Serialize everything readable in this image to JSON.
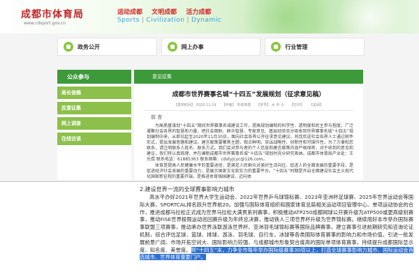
{
  "site": {
    "logo_title": "成都市体育局",
    "logo_url": "www.cdsport.gov.cn",
    "slogans_cn": [
      "运动成都",
      "文明成都",
      "活力成都"
    ],
    "slogans_en": [
      "Sports",
      "Civilization",
      "Dynamic"
    ],
    "nav": [
      "政务公开",
      "网上办事",
      "行业管理"
    ],
    "sidebar": {
      "heading": "公众参与",
      "items": [
        "局长信箱",
        "民意征集",
        "网上调查",
        "在线访谈"
      ]
    },
    "main": {
      "section_title": "意见征集",
      "article_title": "成都市世界赛事名城“十四五”发展规划（征求意见稿）",
      "meta": [
        "【发布时间】 2020-11-19",
        "【作者】 市体育局",
        "【字号】 大 中 小",
        "【打印】",
        "【关闭】"
      ],
      "preface": "前  言",
      "paragraphs": [
        "为高质量谋划“十四五”期间世界赛事名城建设工作，提高规划编制的科学性、透明度和民主参与程度，广泛凝聚社会各界的智慧和力量，把社会期盼、群众智慧、专家意见、基层经验充分吸收到世界赛事名城“十四五”规划编制中来，从即日起至2020年11月30日，面向社会各界公开征求意见建议。热忱欢迎社会各界人士通过邮件形式，提出发展思路和建议。建言献策要聚焦主题，观点鲜明，突出战略性、创新性和可操作性。为了方便和您联系，请注明联系人姓名、联系方式。我们会对参与者的个人信息和建言献策内容严格保密，对于收到的意见和建议，我们将认真梳理，并在编制成都市世界赛事名城“十四五”规划时充分研究吸纳。成都市体育局产业处：王光煜 联系电话：61885363 联系邮箱：cdstyjcyc@126.com。",
        "体育是提高人民健康水平的重要途径，是满足人民群众对美好生活向往、促进人的全面发展的重要手段，是促进经济社会发展的重要动力，是展示国家文化软实力的重要平台。“十四五”时期是开启全面建设社会主义现代化国家新征程的重要开端，是推进体育强国建设、迈向体"
      ]
    }
  },
  "excerpt": {
    "heading": "2.建设世界一流的全球赛事影响力城市",
    "body": "高水平办好2021年世界大学生运动会、2022年世界乒乓球锦标赛、2023年亚洲杯足球赛、2025年世界运动会等国际大赛，SPORTCAL排名跃升世界前20。加强与国际体育组织和国家体育总局相关运动项目管理中心、单项运动协会的合作，推进成都马拉松正式成为世界马拉松大满贯系列赛事，积极推动ATP250成都网球公开赛升级为ATP500或更高级别赛事，推动FISE世界极限运动巡回赛升级为年终总决赛，推动铁人三项世界杯升级为世界锦标赛。继续用好本市举办国际赛事联盟三项赛事，推动承办世界泳联游泳世界杯、亚洲羽毛球锦标赛等国际品牌赛事，建立赛事引进前期研究和咨询论证机制，综合评估足球、篮球、排球、游泳、羽毛球、自行车、冰球等各类国际体育赛事的影响力和市场价值，引进一批发展前景广阔、市场开拓空间大、国际影响力较强、与成都城市形象契合度高的国际单项体育赛事，持续提升成都国际显示度、知名度、美誉度。",
    "highlight": "到“十四五”末，力争全市每年举办国际级赛事30项以上，打造全球赛事影响力城市、国际运动会首选城市、世界体育重要门户。"
  },
  "colors": {
    "header_green": "#3d9a3a",
    "side_item_green": "#8cc04a",
    "logo_red": "#c2272d",
    "highlight_blue": "#2e6fd0"
  }
}
